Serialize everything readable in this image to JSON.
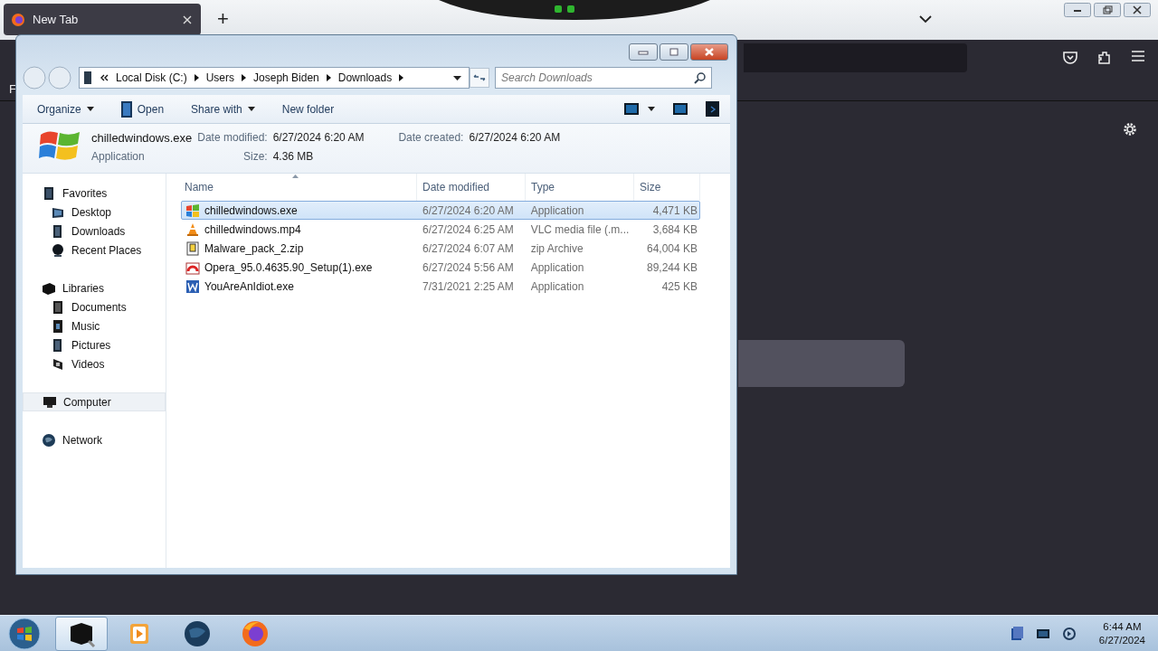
{
  "browser": {
    "tabs": [
      {
        "title": "New Tab",
        "selected": true
      }
    ],
    "new_tab": "+",
    "toolbar_text": "F"
  },
  "explorer": {
    "breadcrumb": [
      "Local Disk (C:)",
      "Users",
      "Joseph Biden",
      "Downloads"
    ],
    "search": {
      "placeholder": "Search Downloads"
    },
    "commands": [
      {
        "label": "Organize",
        "kind": "menu"
      },
      {
        "label": "Open",
        "kind": "app"
      },
      {
        "label": "Share with",
        "kind": "menu"
      },
      {
        "label": "New folder",
        "kind": "plain"
      }
    ],
    "details": {
      "name": "chilledwindows.exe",
      "type": "Application",
      "modified_label": "Date modified:",
      "modified": "6/27/2024 6:20 AM",
      "created_label": "Date created:",
      "created": "6/27/2024 6:20 AM",
      "size_label": "Size:",
      "size": "4.36 MB"
    },
    "sidebar": [
      {
        "label": "Favorites",
        "kind": "star",
        "selected": false,
        "children": [
          {
            "label": "Desktop",
            "kind": "desktop",
            "selected": false
          },
          {
            "label": "Downloads",
            "kind": "folder",
            "selected": false
          },
          {
            "label": "Recent Places",
            "kind": "dot",
            "selected": false
          }
        ]
      },
      {
        "label": "Libraries",
        "kind": "library",
        "selected": false,
        "children": [
          {
            "label": "Documents",
            "kind": "doc",
            "selected": false
          },
          {
            "label": "Music",
            "kind": "music",
            "selected": false
          },
          {
            "label": "Pictures",
            "kind": "folder",
            "selected": false
          },
          {
            "label": "Videos",
            "kind": "video",
            "selected": false
          }
        ]
      },
      {
        "label": "Computer",
        "kind": "computer",
        "selected": true
      },
      {
        "label": "Network",
        "kind": "globe",
        "selected": false
      }
    ],
    "columns": [
      "Name",
      "Date modified",
      "Type",
      "Size"
    ],
    "rows": [
      {
        "name": "chilledwindows.exe",
        "kind": "windows",
        "date": "6/27/2024 6:20 AM",
        "type": "Application",
        "size": "4,471 KB",
        "selected": true
      },
      {
        "name": "chilledwindows.mp4",
        "kind": "vlc",
        "date": "6/27/2024 6:25 AM",
        "type": "VLC media file (.m...",
        "size": "3,684 KB",
        "selected": false
      },
      {
        "name": "Malware_pack_2.zip",
        "kind": "zip",
        "date": "6/27/2024 6:07 AM",
        "type": "zip Archive",
        "size": "64,004 KB",
        "selected": false
      },
      {
        "name": "Opera_95.0.4635.90_Setup(1).exe",
        "kind": "opera",
        "date": "6/27/2024 5:56 AM",
        "type": "Application",
        "size": "89,244 KB",
        "selected": false
      },
      {
        "name": "YouAreAnIdiot.exe",
        "kind": "word",
        "date": "7/31/2021 2:25 AM",
        "type": "Application",
        "size": "425 KB",
        "selected": false
      }
    ]
  },
  "taskbar": {
    "apps": [
      {
        "kind": "box",
        "selected": true
      },
      {
        "kind": "media",
        "selected": false
      },
      {
        "kind": "globe",
        "selected": false
      },
      {
        "kind": "firefox",
        "selected": false
      }
    ],
    "time": "6:44 AM",
    "date": "6/27/2024"
  }
}
